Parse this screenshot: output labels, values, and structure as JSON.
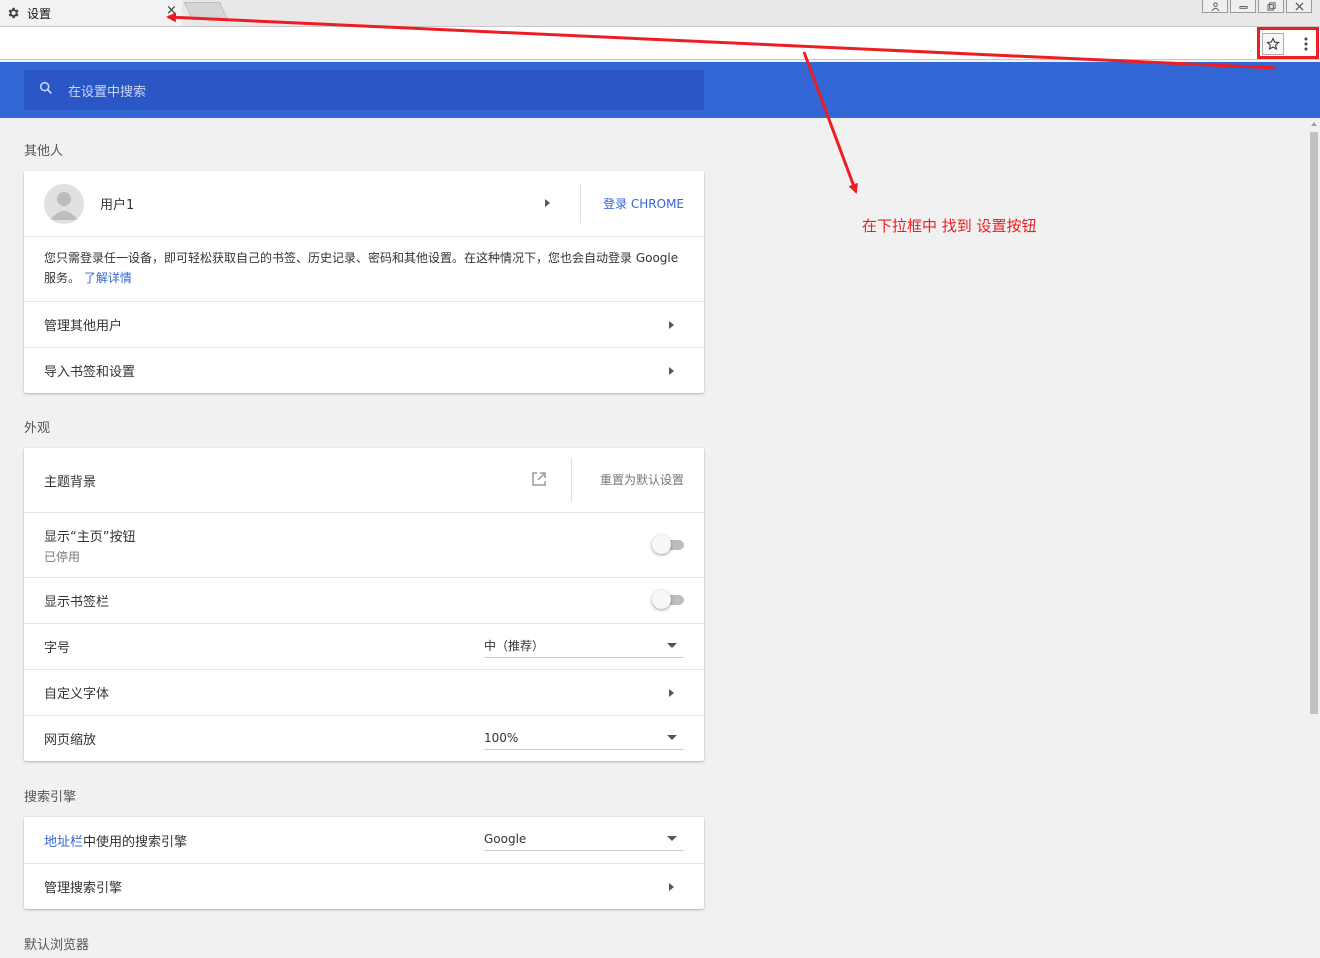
{
  "browser": {
    "tab_title": "设置",
    "close_glyph": "×",
    "window_buttons": [
      "user-icon",
      "minimize-icon",
      "restore-icon",
      "close-icon"
    ]
  },
  "search": {
    "placeholder": "在设置中搜索"
  },
  "sections": {
    "people": {
      "title": "其他人",
      "user_name": "用户1",
      "sign_in": "登录 CHROME",
      "description": "您只需登录任一设备，即可轻松获取自己的书签、历史记录、密码和其他设置。在这种情况下，您也会自动登录 Google 服务。",
      "learn_more": "了解详情",
      "manage_users": "管理其他用户",
      "import": "导入书签和设置"
    },
    "appearance": {
      "title": "外观",
      "theme": "主题背景",
      "reset_theme": "重置为默认设置",
      "show_home": "显示“主页”按钮",
      "show_home_status": "已停用",
      "show_bookmarks": "显示书签栏",
      "font_size": "字号",
      "font_size_value": "中（推荐）",
      "custom_fonts": "自定义字体",
      "page_zoom": "网页缩放",
      "page_zoom_value": "100%"
    },
    "search_engine": {
      "title": "搜索引擎",
      "address_bar_link": "地址栏",
      "address_bar_rest": "中使用的搜索引擎",
      "engine_value": "Google",
      "manage": "管理搜索引擎"
    },
    "default_browser": {
      "title": "默认浏览器"
    }
  },
  "annotation": {
    "text": "在下拉框中 找到 设置按钮",
    "color": "#ee1d24"
  },
  "colors": {
    "header_blue": "#3367d6",
    "search_blue": "#2a56c6",
    "link_blue": "#3367d6"
  }
}
